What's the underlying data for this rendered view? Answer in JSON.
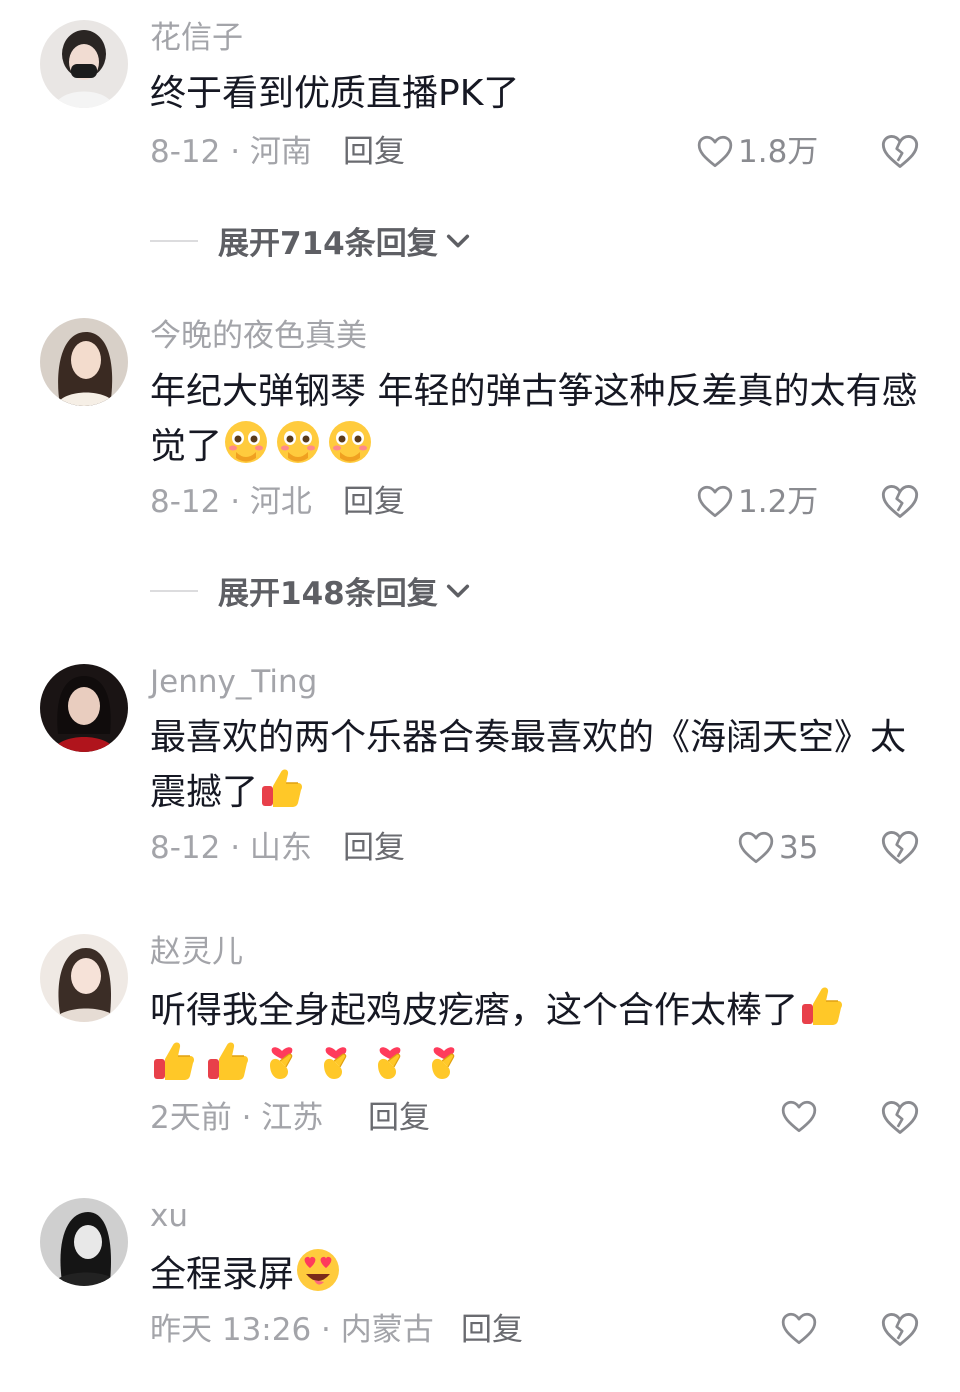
{
  "comments": [
    {
      "username": "花信子",
      "text": "终于看到优质直播PK了",
      "date_location": "8-12 · 河南",
      "reply_label": "回复",
      "likes": "1.8万",
      "expand_label": "展开714条回复"
    },
    {
      "username": "今晚的夜色真美",
      "text": "年纪大弹钢琴 年轻的弹古筝这种反差真的太有感觉了",
      "emojis": [
        "blush-emoji",
        "blush-emoji",
        "blush-emoji"
      ],
      "date_location": "8-12 · 河北",
      "reply_label": "回复",
      "likes": "1.2万",
      "expand_label": "展开148条回复"
    },
    {
      "username": "Jenny_Ting",
      "text": "最喜欢的两个乐器合奏最喜欢的《海阔天空》太震撼了",
      "emojis": [
        "thumbs-up-emoji"
      ],
      "date_location": "8-12 · 山东",
      "reply_label": "回复",
      "likes": "35"
    },
    {
      "username": "赵灵儿",
      "text": "听得我全身起鸡皮疙瘩，这个合作太棒了",
      "emojis": [
        "thumbs-up-emoji"
      ],
      "emojis_line2": [
        "thumbs-up-emoji",
        "thumbs-up-emoji",
        "finger-heart-emoji",
        "finger-heart-emoji",
        "finger-heart-emoji",
        "finger-heart-emoji"
      ],
      "date_location": "2天前 · 江苏",
      "reply_label": "回复",
      "likes": ""
    },
    {
      "username": "xu",
      "text": "全程录屏",
      "emojis": [
        "heart-eyes-emoji"
      ],
      "date_location": "昨天 13:26 · 内蒙古",
      "reply_label": "回复",
      "likes": ""
    }
  ],
  "colors": {
    "username": "#a3a4a9",
    "text": "#161823",
    "meta": "#a3a4a9",
    "reply": "#6a6b70"
  }
}
